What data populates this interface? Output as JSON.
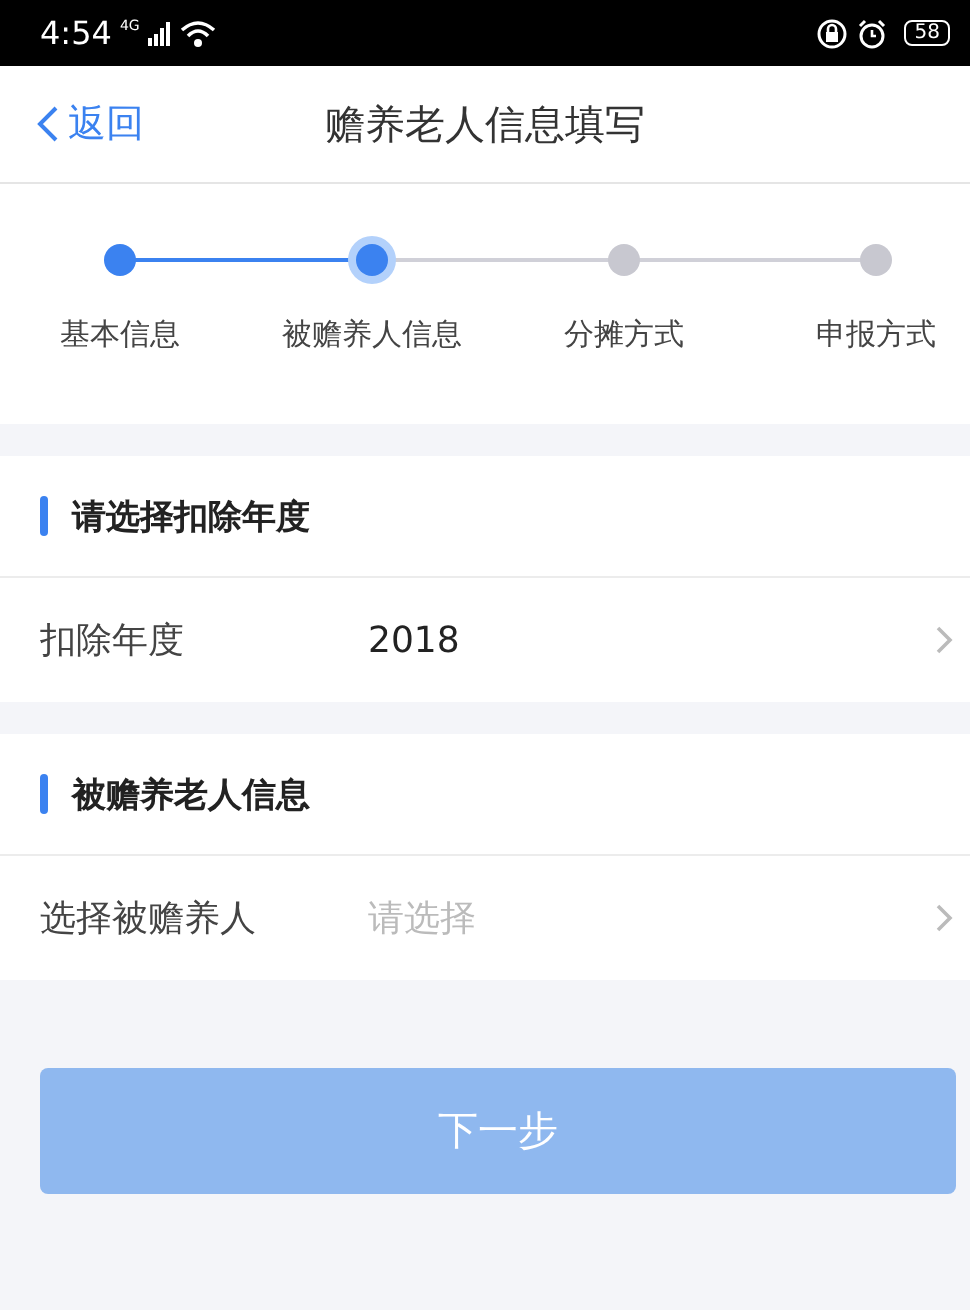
{
  "status_bar": {
    "time": "4:54",
    "network": "4G",
    "battery": "58"
  },
  "nav": {
    "back": "返回",
    "title": "赡养老人信息填写"
  },
  "steps": [
    {
      "label": "基本信息",
      "done": true,
      "selected": false
    },
    {
      "label": "被赡养人信息",
      "done": true,
      "selected": true
    },
    {
      "label": "分摊方式",
      "done": false,
      "selected": false
    },
    {
      "label": "申报方式",
      "done": false,
      "selected": false
    }
  ],
  "sections": [
    {
      "title": "请选择扣除年度",
      "row": {
        "label": "扣除年度",
        "value": "2018"
      }
    },
    {
      "title": "被赡养老人信息",
      "row": {
        "label": "选择被赡养人",
        "placeholder": "请选择"
      }
    }
  ],
  "next_button": {
    "label": "下一步",
    "disabled": true
  }
}
